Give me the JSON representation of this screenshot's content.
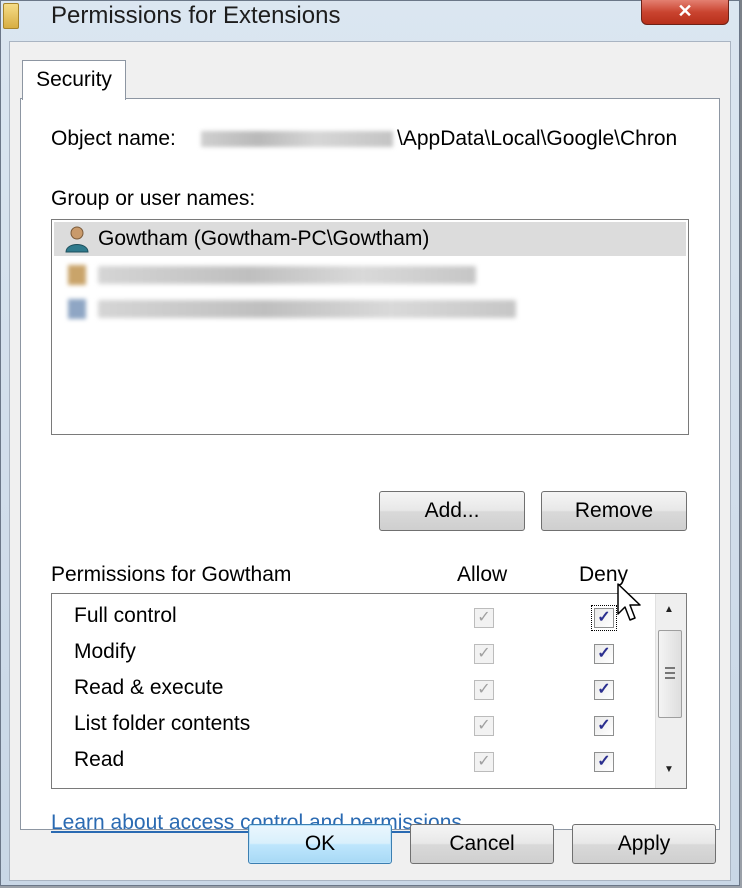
{
  "window": {
    "title": "Permissions for Extensions",
    "close_label": "✕"
  },
  "tab": {
    "label": "Security"
  },
  "object": {
    "label": "Object name:",
    "path_visible": "\\AppData\\Local\\Google\\Chron"
  },
  "groups": {
    "label": "Group or user names:",
    "users": [
      {
        "name": "Gowtham (Gowtham-PC\\Gowtham)",
        "selected": true
      }
    ]
  },
  "buttons": {
    "add": "Add...",
    "remove": "Remove",
    "ok": "OK",
    "cancel": "Cancel",
    "apply": "Apply"
  },
  "permissions": {
    "header": "Permissions for Gowtham",
    "allow_header": "Allow",
    "deny_header": "Deny",
    "rows": [
      {
        "label": "Full control",
        "allow": true,
        "deny": true
      },
      {
        "label": "Modify",
        "allow": true,
        "deny": true
      },
      {
        "label": "Read & execute",
        "allow": true,
        "deny": true
      },
      {
        "label": "List folder contents",
        "allow": true,
        "deny": true
      },
      {
        "label": "Read",
        "allow": true,
        "deny": true
      }
    ]
  },
  "link": "Learn about access control and permissions",
  "icons": {
    "check": "✓",
    "scroll_up": "▲",
    "scroll_down": "▼"
  }
}
